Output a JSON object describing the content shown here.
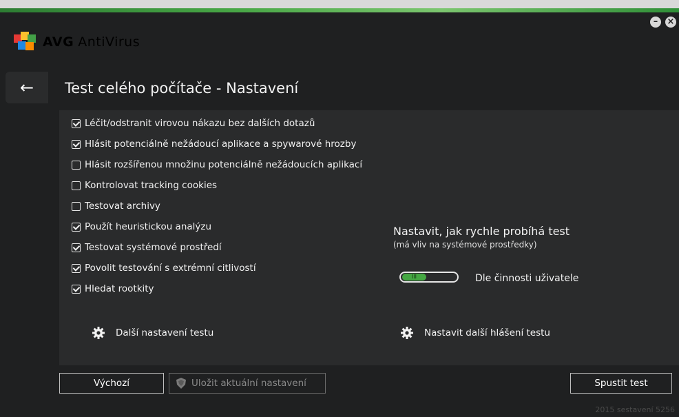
{
  "app": {
    "brand": "AVG",
    "product": "AntiVirus"
  },
  "window_controls": {
    "minimize": "–",
    "close": "×"
  },
  "header": {
    "back_icon": "←",
    "title": "Test celého počítače - Nastavení"
  },
  "options": [
    {
      "label": "Léčit/odstranit virovou nákazu bez dalších dotazů",
      "checked": true
    },
    {
      "label": "Hlásit potenciálně nežádoucí aplikace a spywarové hrozby",
      "checked": true
    },
    {
      "label": "Hlásit rozšířenou množinu potenciálně nežádoucích aplikací",
      "checked": false
    },
    {
      "label": "Kontrolovat tracking cookies",
      "checked": false
    },
    {
      "label": "Testovat archivy",
      "checked": false
    },
    {
      "label": "Použít heuristickou analýzu",
      "checked": true
    },
    {
      "label": "Testovat systémové prostředí",
      "checked": true
    },
    {
      "label": "Povolit testování s extrémní citlivostí",
      "checked": true
    },
    {
      "label": "Hledat rootkity",
      "checked": true
    }
  ],
  "speed": {
    "title": "Nastavit, jak rychle probíhá test",
    "subtitle": "(má vliv na systémové prostředky)",
    "value_label": "Dle činnosti uživatele",
    "level_fraction": 0.45
  },
  "links": {
    "more_settings": "Další nastavení testu",
    "more_reports": "Nastavit další hlášení testu"
  },
  "buttons": {
    "default": "Výchozí",
    "save": "Uložit aktuální nastavení",
    "run": "Spustit test"
  },
  "footer": {
    "version": "2015  sestavení 5256"
  },
  "colors": {
    "accent": "#45a843",
    "background": "#1f2021",
    "panel": "#2a2b2c"
  }
}
